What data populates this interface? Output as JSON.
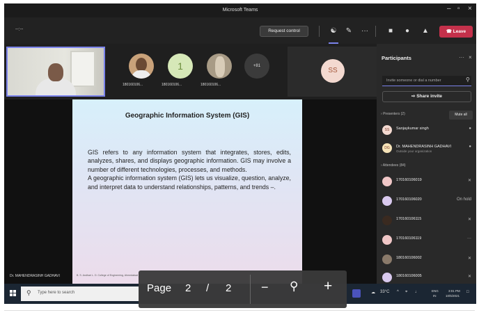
{
  "window": {
    "title": "Microsoft Teams"
  },
  "toolbar": {
    "timer": "--:--",
    "request_control": "Request control",
    "leave": "Leave"
  },
  "participant_tiles": [
    {
      "name": "180160106..."
    },
    {
      "name": "180160106...",
      "initial": "1"
    },
    {
      "name": "180160106..."
    }
  ],
  "more_count": "+81",
  "ss_initials": "SS",
  "presenter_label": "Dr. MAHENDRASINH GADHAVI",
  "slide": {
    "title": "Geographic Information System (GIS)",
    "paragraph1": "GIS refers to any information system that integrates, stores, edits, analyzes, shares, and displays geographic information. GIS may involve a number of different technologies, processes, and methods.",
    "paragraph2": "A geographic information system (GIS) lets us visualize, question, analyze, and interpret data to understand relationships, patterns, and trends –.",
    "footer": "B. S. Andhari L. D. College of Engineering, Ahmedabad"
  },
  "panel": {
    "title": "Participants",
    "invite_placeholder": "Invite someone or dial a number",
    "share_invite": "Share invite",
    "presenters_label": "Presenters (2)",
    "mute_all": "Mute all",
    "attendees_label": "Attendees (84)",
    "presenters": [
      {
        "initials": "SS",
        "name": "Sanjaykumar singh",
        "sub": ""
      },
      {
        "initials": "DG",
        "name": "Dr. MAHENDRASINH GADHAVI",
        "sub": "Outside your organization"
      }
    ],
    "attendees": [
      {
        "name": "170160106019",
        "status": ""
      },
      {
        "name": "170160106020",
        "status": "On hold"
      },
      {
        "name": "170160106115",
        "status": ""
      },
      {
        "name": "170160106119",
        "status": "···"
      },
      {
        "name": "180160106002",
        "status": ""
      },
      {
        "name": "180160106005",
        "status": ""
      }
    ]
  },
  "taskbar": {
    "search_placeholder": "Type here to search",
    "temperature": "33°C",
    "lang_top": "ENG",
    "lang_bottom": "IN",
    "time": "3:01 PM",
    "date": "10/5/2021"
  },
  "pdf": {
    "page_label": "Page",
    "current_page": "2",
    "separator": "/",
    "total_pages": "2",
    "zoom_out": "−",
    "zoom_in": "+"
  },
  "colors": {
    "accent": "#7b83eb",
    "leave": "#c4314b",
    "taskbar": "#1b2633"
  }
}
